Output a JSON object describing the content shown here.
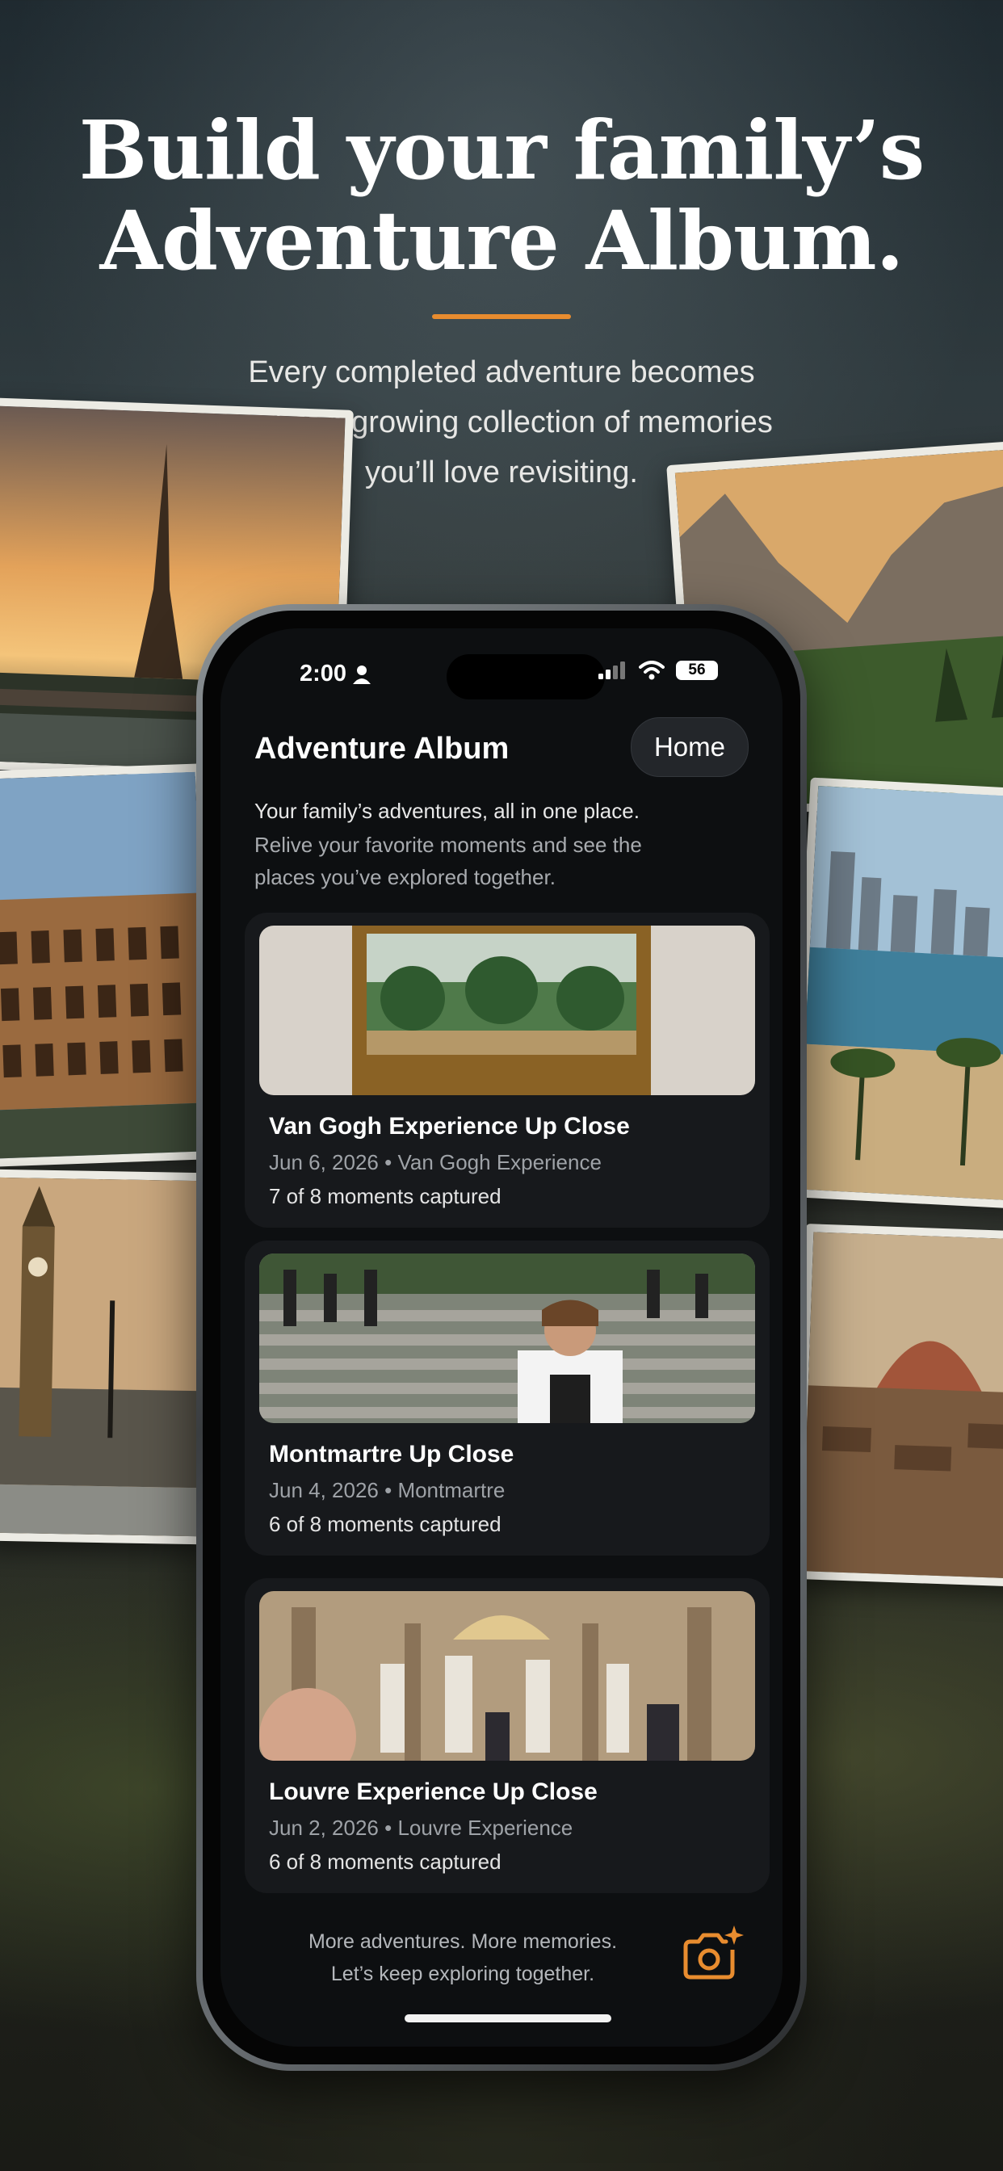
{
  "headline": {
    "line1": "Build your family’s",
    "line2": "Adventure Album."
  },
  "subhead": {
    "line1": "Every completed adventure becomes",
    "line2": "part of a growing collection of memories",
    "line3": "you’ll love revisiting."
  },
  "colors": {
    "accent": "#e88c2f",
    "screen_bg": "#0d0f11",
    "card_bg": "#17191c"
  },
  "status_bar": {
    "time": "2:00",
    "battery": "56"
  },
  "app": {
    "title": "Adventure Album",
    "home_button": "Home",
    "intro_line": "Your family’s adventures, all in one place.",
    "intro_detail": "Relive your favorite moments and see the places you’ve explored together."
  },
  "entries": [
    {
      "title": "Van Gogh Experience Up Close",
      "meta": "Jun 6, 2026 • Van Gogh Experience",
      "moments": "7 of 8 moments captured"
    },
    {
      "title": "Montmartre Up Close",
      "meta": "Jun 4, 2026 • Montmartre",
      "moments": "6 of 8 moments captured"
    },
    {
      "title": "Louvre Experience Up Close",
      "meta": "Jun 2, 2026 • Louvre Experience",
      "moments": "6 of 8 moments captured"
    }
  ],
  "footer": {
    "line1": "More adventures. More memories.",
    "line2": "Let’s keep exploring together.",
    "icon": "camera-sparkle-icon"
  }
}
